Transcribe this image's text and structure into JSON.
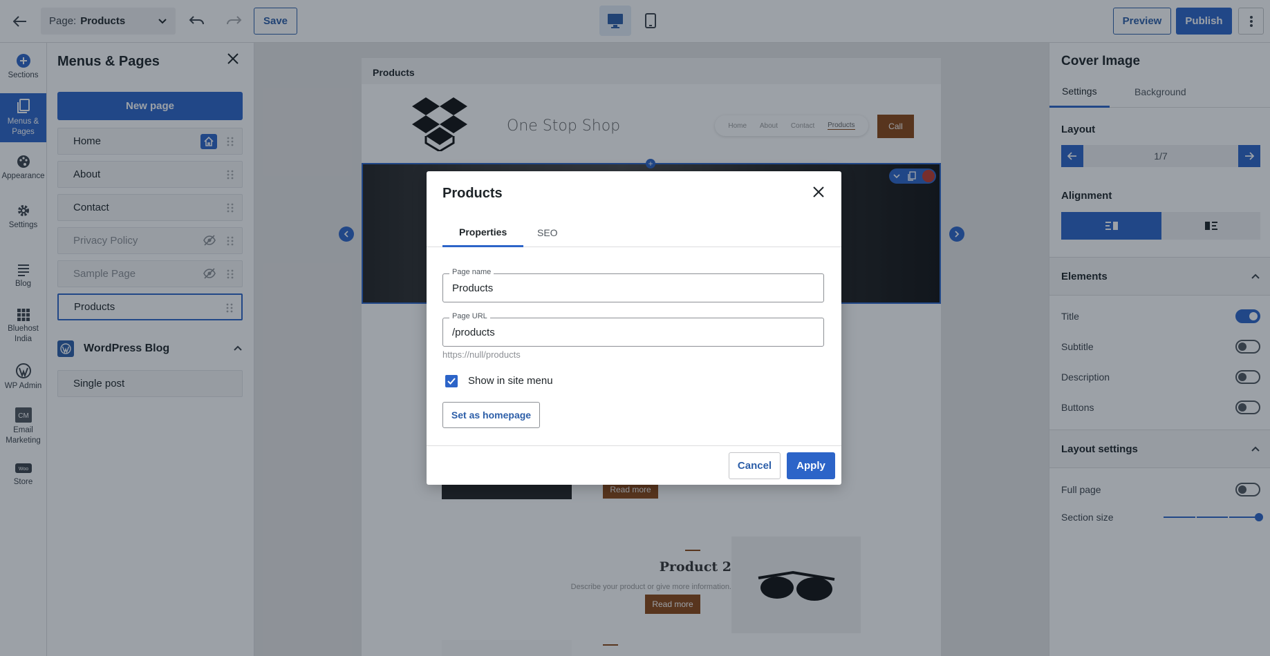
{
  "topbar": {
    "page_label": "Page:",
    "page_value": "Products",
    "save_label": "Save",
    "preview_label": "Preview",
    "publish_label": "Publish"
  },
  "leftnav": [
    {
      "label": "Sections",
      "icon": "plus-circle-icon"
    },
    {
      "label": "Menus & Pages",
      "icon": "pages-icon"
    },
    {
      "label": "Appearance",
      "icon": "palette-icon"
    },
    {
      "label": "Settings",
      "icon": "gear-icon"
    },
    {
      "label": "Blog",
      "icon": "blog-icon"
    },
    {
      "label": "Bluehost India",
      "icon": "grid-icon"
    },
    {
      "label": "WP Admin",
      "icon": "wordpress-icon"
    },
    {
      "label": "Email Marketing",
      "icon": "cm-icon"
    },
    {
      "label": "Store",
      "icon": "woo-icon"
    }
  ],
  "menus_panel": {
    "title": "Menus & Pages",
    "new_page_label": "New page",
    "pages": [
      {
        "label": "Home",
        "state": "home"
      },
      {
        "label": "About",
        "state": "normal"
      },
      {
        "label": "Contact",
        "state": "normal"
      },
      {
        "label": "Privacy Policy",
        "state": "hidden"
      },
      {
        "label": "Sample Page",
        "state": "hidden"
      },
      {
        "label": "Products",
        "state": "selected"
      }
    ],
    "blog_title": "WordPress Blog",
    "blog_items": [
      {
        "label": "Single post"
      }
    ]
  },
  "site": {
    "page_bar": "Products",
    "site_name": "One Stop Shop",
    "nav": [
      "Home",
      "About",
      "Contact",
      "Products"
    ],
    "call_label": "Call",
    "readmore_label": "Read more",
    "product2_title": "Product 2",
    "product2_desc": "Describe your product or give more information."
  },
  "right_panel": {
    "title": "Cover Image",
    "tabs": [
      "Settings",
      "Background"
    ],
    "layout_title": "Layout",
    "layout_value": "1/7",
    "alignment_title": "Alignment",
    "elements_title": "Elements",
    "elements": [
      {
        "label": "Title",
        "on": true
      },
      {
        "label": "Subtitle",
        "on": false
      },
      {
        "label": "Description",
        "on": false
      },
      {
        "label": "Buttons",
        "on": false
      }
    ],
    "layout_settings_title": "Layout settings",
    "full_page_label": "Full page",
    "full_page_on": false,
    "section_size_label": "Section size",
    "section_size_value": 1.0
  },
  "modal": {
    "title": "Products",
    "tabs": [
      "Properties",
      "SEO"
    ],
    "page_name_label": "Page name",
    "page_name_value": "Products",
    "page_url_label": "Page URL",
    "page_url_value": "/products",
    "url_hint": "https://null/products",
    "show_in_menu_label": "Show in site menu",
    "show_in_menu_checked": true,
    "set_homepage_label": "Set as homepage",
    "cancel_label": "Cancel",
    "apply_label": "Apply"
  },
  "colors": {
    "accent": "#2c64c8",
    "brand_brown": "#8b4513"
  }
}
